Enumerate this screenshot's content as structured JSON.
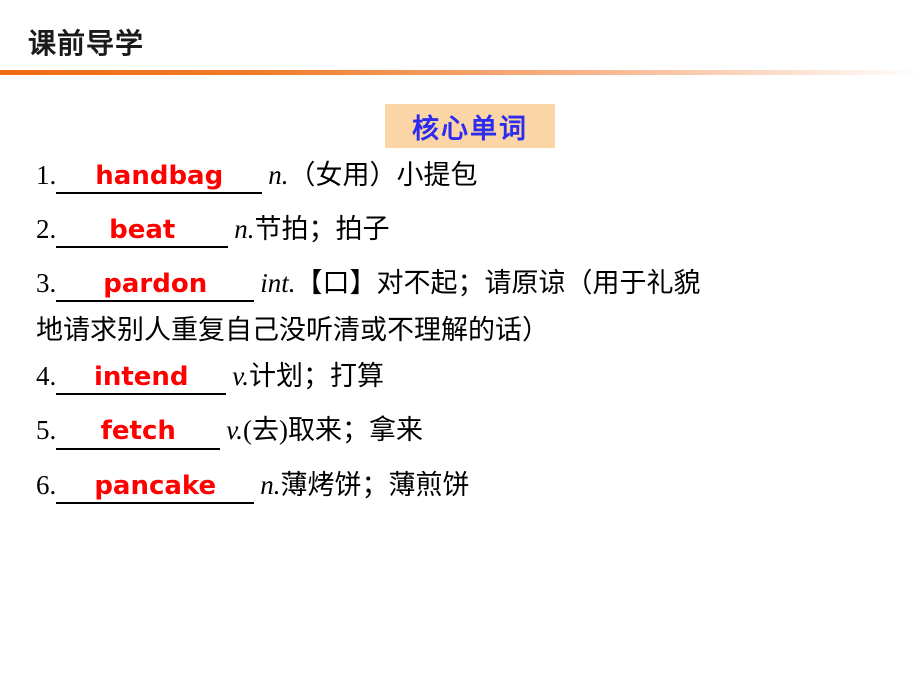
{
  "header": {
    "title": "课前导学"
  },
  "section": {
    "banner_label": "核心单词"
  },
  "entries": [
    {
      "num": "1.",
      "answer": "handbag",
      "pos": "n.",
      "meaning": "（女用）小提包"
    },
    {
      "num": "2.",
      "answer": "beat",
      "pos": "n.",
      "meaning": "节拍；拍子"
    },
    {
      "num": "3.",
      "answer": "pardon",
      "pos": "int.",
      "meaning": "【口】对不起；请原谅（用于礼貌",
      "continuation": "地请求别人重复自己没听清或不理解的话）"
    },
    {
      "num": "4.",
      "answer": "intend",
      "pos": "v.",
      "meaning": "计划；打算"
    },
    {
      "num": "5.",
      "answer": "fetch",
      "pos": "v.",
      "meaning": "(去)取来；拿来"
    },
    {
      "num": "6.",
      "answer": "pancake",
      "pos": "n.",
      "meaning": "薄烤饼；薄煎饼"
    }
  ],
  "colors": {
    "answer_red": "#ff0000",
    "banner_bg": "#fbd5a5",
    "banner_text": "#2c2cf0",
    "rule_orange": "#ef6a12"
  }
}
